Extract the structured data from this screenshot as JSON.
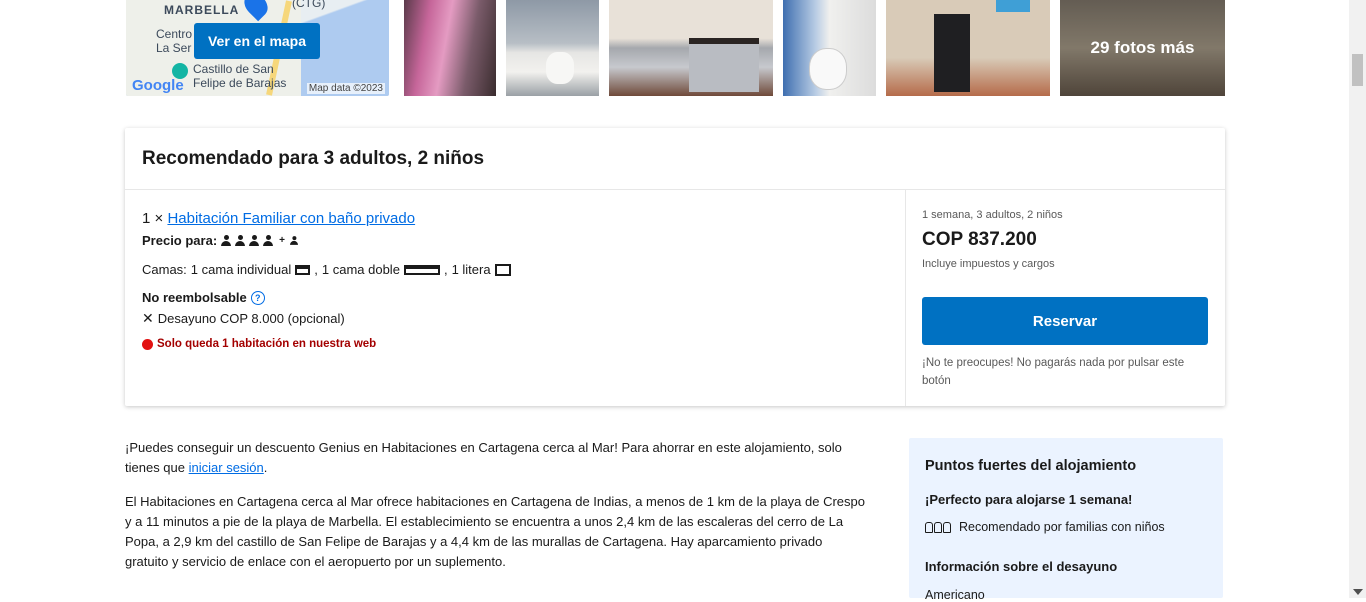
{
  "map": {
    "labels": [
      "MARBELLA",
      "(CTG)",
      "Centro",
      "La Ser",
      "Castillo de San",
      "Felipe de Barajas"
    ],
    "button_label": "Ver en el mapa",
    "google_label": "Google",
    "map_data_label": "Map data ©2023"
  },
  "photos": {
    "more_label": "29 fotos más",
    "count": 6
  },
  "recommendation": {
    "title": "Recomendado para 3 adultos, 2 niños",
    "room_qty": "1 ×",
    "room_name": "Habitación Familiar con baño privado",
    "price_for_label": "Precio para:",
    "beds_label": "Camas:",
    "beds": [
      "1 cama individual",
      "1 cama doble",
      "1 litera"
    ],
    "non_refundable": "No reembolsable",
    "breakfast": "Desayuno COP 8.000 (opcional)",
    "urgency": "Solo queda 1 habitación en nuestra web"
  },
  "pricing": {
    "stay_meta": "1 semana, 3 adultos, 2 niños",
    "price": "COP 837.200",
    "taxes": "Incluye impuestos y cargos",
    "reserve_label": "Reservar",
    "reassure": "¡No te preocupes! No pagarás nada por pulsar este botón"
  },
  "description": {
    "genius_text": "¡Puedes conseguir un descuento Genius en Habitaciones en Cartagena cerca al Mar! Para ahorrar en este alojamiento, solo tienes que",
    "genius_link": "iniciar sesión",
    "genius_end": ".",
    "paragraph2": "El Habitaciones en Cartagena cerca al Mar ofrece habitaciones en Cartagena de Indias, a menos de 1 km de la playa de Crespo y a 11 minutos a pie de la playa de Marbella. El establecimiento se encuentra a unos 2,4 km de las escaleras del cerro de La Popa, a 2,9 km del castillo de San Felipe de Barajas y a 4,4 km de las murallas de Cartagena. Hay aparcamiento privado gratuito y servicio de enlace con el aeropuerto por un suplemento."
  },
  "highlights": {
    "title": "Puntos fuertes del alojamiento",
    "stay_line": "¡Perfecto para alojarse 1 semana!",
    "family_line": "Recomendado por familias con niños",
    "breakfast_title": "Información sobre el desayuno",
    "breakfast_type": "Americano"
  },
  "colors": {
    "primary_button": "#0071c2",
    "link": "#006ce4",
    "urgency": "#a30000",
    "highlight_bg": "#ebf3ff"
  }
}
